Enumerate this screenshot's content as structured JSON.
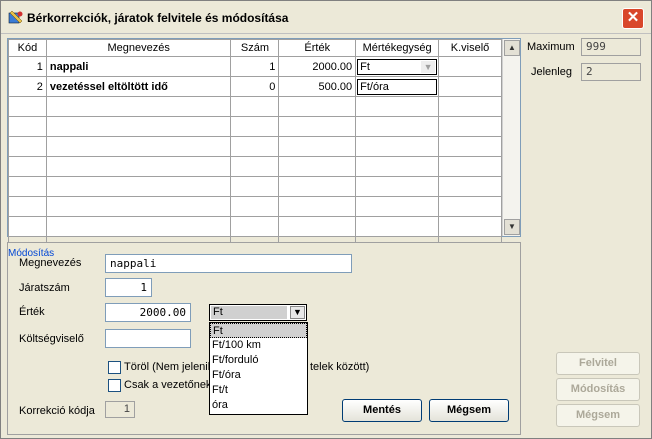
{
  "window": {
    "title": "Bérkorrekciók, járatok felvitele és módosítása",
    "close_label": "✕"
  },
  "grid": {
    "headers": [
      "Kód",
      "Megnevezés",
      "Szám",
      "Érték",
      "Mértékegység",
      "K.viselő"
    ],
    "rows": [
      {
        "kod": "1",
        "nev": "nappali",
        "szam": "1",
        "ertek": "2000.00",
        "me": "Ft",
        "kv": ""
      },
      {
        "kod": "2",
        "nev": "vezetéssel eltöltött idő",
        "szam": "0",
        "ertek": "500.00",
        "me": "Ft/óra",
        "kv": ""
      }
    ],
    "empty_rows": 8
  },
  "side": {
    "max_label": "Maximum",
    "max_value": "999",
    "cur_label": "Jelenleg",
    "cur_value": "2"
  },
  "form": {
    "legend": "Módosítás",
    "nev_label": "Megnevezés",
    "nev_value": "nappali",
    "jarat_label": "Járatszám",
    "jarat_value": "1",
    "ertek_label": "Érték",
    "ertek_value": "2000.00",
    "unit_value": "Ft",
    "kv_label": "Költségviselő",
    "kv_value": "",
    "torol_label": "Töröl (Nem jelenik meg a kiválasztható tételek között)",
    "torol_visible_left": "Töröl (Nem jelenik",
    "torol_visible_right": "telek között)",
    "csak_label": "Csak a vezetőnek",
    "korr_label": "Korrekció kódja",
    "korr_value": "1",
    "save_label": "Mentés",
    "cancel_label": "Mégsem"
  },
  "dropdown": {
    "options": [
      "Ft",
      "Ft/100 km",
      "Ft/forduló",
      "Ft/óra",
      "Ft/t",
      "óra"
    ],
    "selected": "Ft"
  },
  "right_buttons": {
    "felvitel": "Felvitel",
    "modositas": "Módosítás",
    "megsem": "Mégsem"
  }
}
